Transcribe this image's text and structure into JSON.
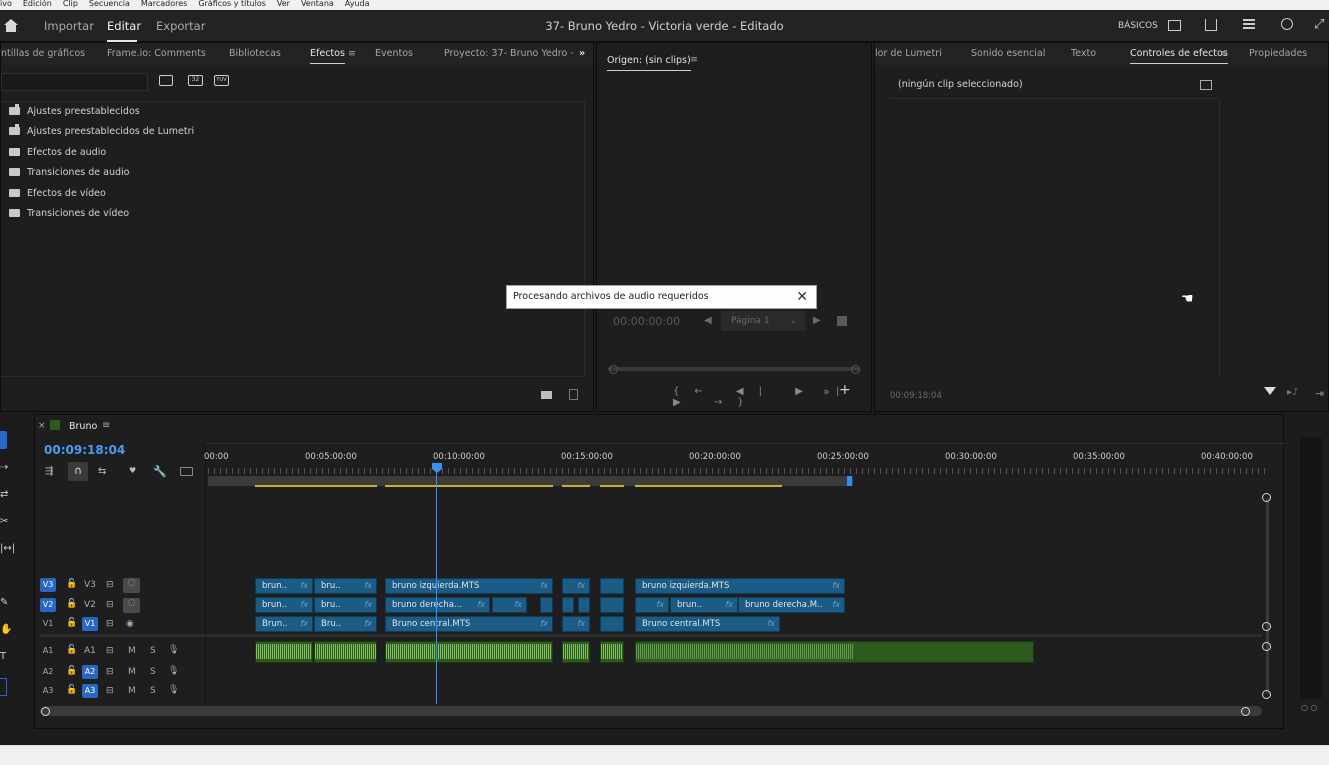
{
  "menu": [
    "ivo",
    "Edición",
    "Clip",
    "Secuencia",
    "Marcadores",
    "Gráficos y títulos",
    "Ver",
    "Ventana",
    "Ayuda"
  ],
  "header": {
    "tabs": [
      "Importar",
      "Editar",
      "Exportar"
    ],
    "title": "37- Bruno Yedro - Victoria verde - Editado",
    "workspace": "BÁSICOS"
  },
  "left_panel": {
    "tabs": [
      "ntillas de gráficos",
      "Frame.io: Comments",
      "Bibliotecas",
      "Efectos",
      "Eventos",
      "Proyecto: 37- Bruno Yedro - Vic"
    ],
    "items": [
      "Ajustes preestablecidos",
      "Ajustes preestablecidos de Lumetri",
      "Efectos de audio",
      "Transiciones de audio",
      "Efectos de vídeo",
      "Transiciones de vídeo"
    ],
    "toolbar": [
      "32",
      "YUV"
    ]
  },
  "source": {
    "tab": "Origen: (sin clips)",
    "timecode": "00:00:00:00",
    "page": "Página 1"
  },
  "effects": {
    "tabs": [
      "lor de Lumetri",
      "Sonido esencial",
      "Texto",
      "Controles de efectos",
      "Propiedades"
    ],
    "no_clip": "(ningún clip seleccionado)",
    "timecode": "00:09:18:04"
  },
  "toast": {
    "text": "Procesando archivos de audio requeridos"
  },
  "timeline": {
    "name": "Bruno",
    "timecode": "00:09:18:04",
    "ruler": [
      "00:00",
      "00:05:00:00",
      "00:10:00:00",
      "00:15:00:00",
      "00:20:00:00",
      "00:25:00:00",
      "00:30:00:00",
      "00:35:00:00",
      "00:40:00:00"
    ],
    "video_tracks": [
      {
        "src": "V3",
        "name": "V3"
      },
      {
        "src": "V2",
        "name": "V2"
      },
      {
        "src": "V1",
        "name": "V1"
      }
    ],
    "audio_tracks": [
      {
        "src": "A1",
        "name": "A1"
      },
      {
        "src": "A2",
        "name": "A2"
      },
      {
        "src": "A3",
        "name": "A3"
      }
    ],
    "clip_labels": {
      "a": "brun..",
      "b": "bru..",
      "c": "bruno izquierda.MTS",
      "d": "bruno derecha...",
      "e": "Brun..",
      "f": "Bru..",
      "g": "Bruno central.MTS",
      "h": "bruno izquierda.MTS",
      "i": "brun..",
      "j": "bruno derecha.M..",
      "k": "Bruno central.MTS",
      "fx": "fx"
    },
    "ms": {
      "m": "M",
      "s": "S"
    }
  }
}
